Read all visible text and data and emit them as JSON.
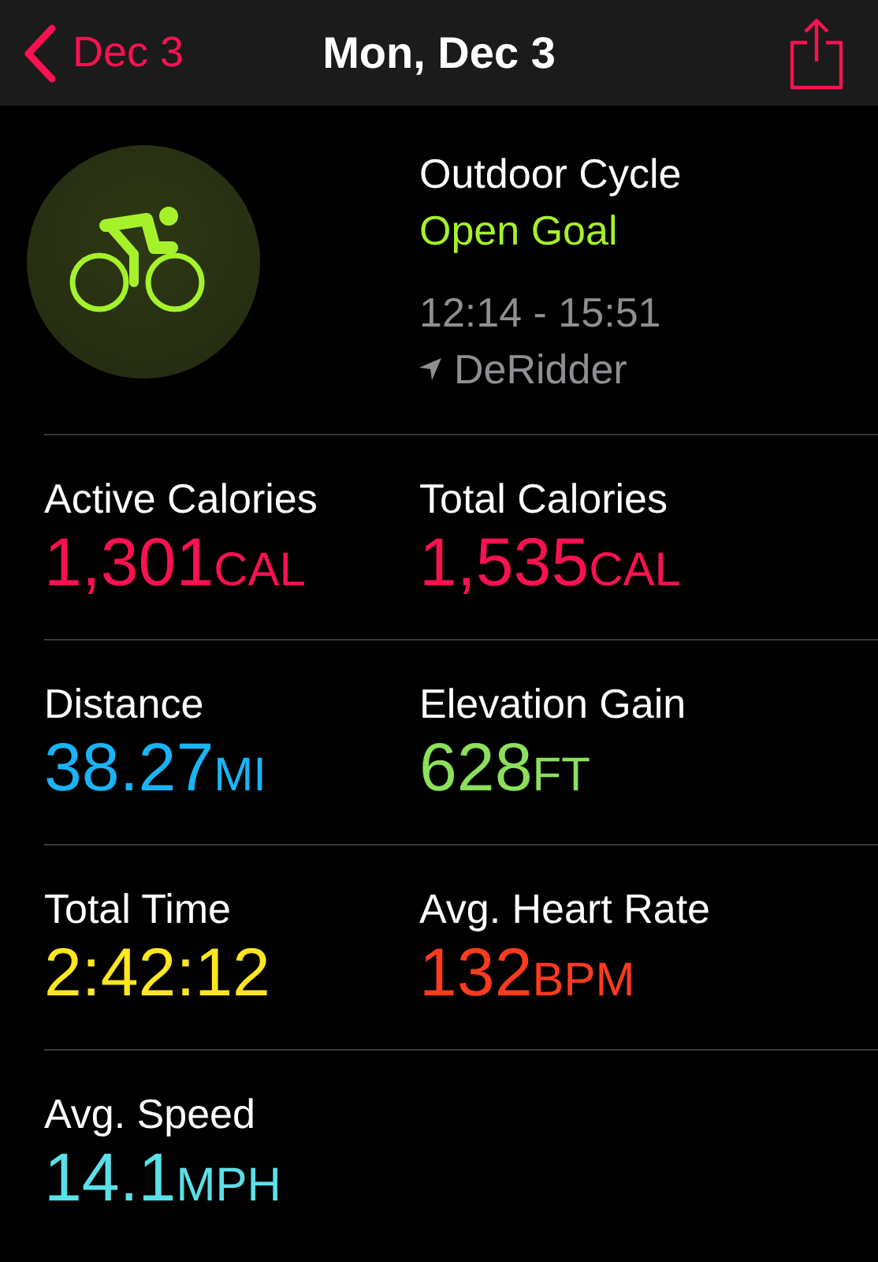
{
  "nav": {
    "back_label": "Dec 3",
    "title": "Mon, Dec 3"
  },
  "workout": {
    "name": "Outdoor Cycle",
    "goal": "Open Goal",
    "time_range": "12:14 - 15:51",
    "location": "DeRidder"
  },
  "metrics": [
    {
      "label": "Active Calories",
      "value": "1,301",
      "unit": "CAL",
      "color": "#fa1150"
    },
    {
      "label": "Total Calories",
      "value": "1,535",
      "unit": "CAL",
      "color": "#fa1150"
    },
    {
      "label": "Distance",
      "value": "38.27",
      "unit": "MI",
      "color": "#1ab4f5"
    },
    {
      "label": "Elevation Gain",
      "value": "628",
      "unit": "FT",
      "color": "#8be05c"
    },
    {
      "label": "Total Time",
      "value": "2:42:12",
      "color": "#ffe620"
    },
    {
      "label": "Avg. Heart Rate",
      "value": "132",
      "unit": "BPM",
      "color": "#ff3b1f"
    },
    {
      "label": "Avg. Speed",
      "value": "14.1",
      "unit": "MPH",
      "color": "#5ae0e8"
    }
  ]
}
